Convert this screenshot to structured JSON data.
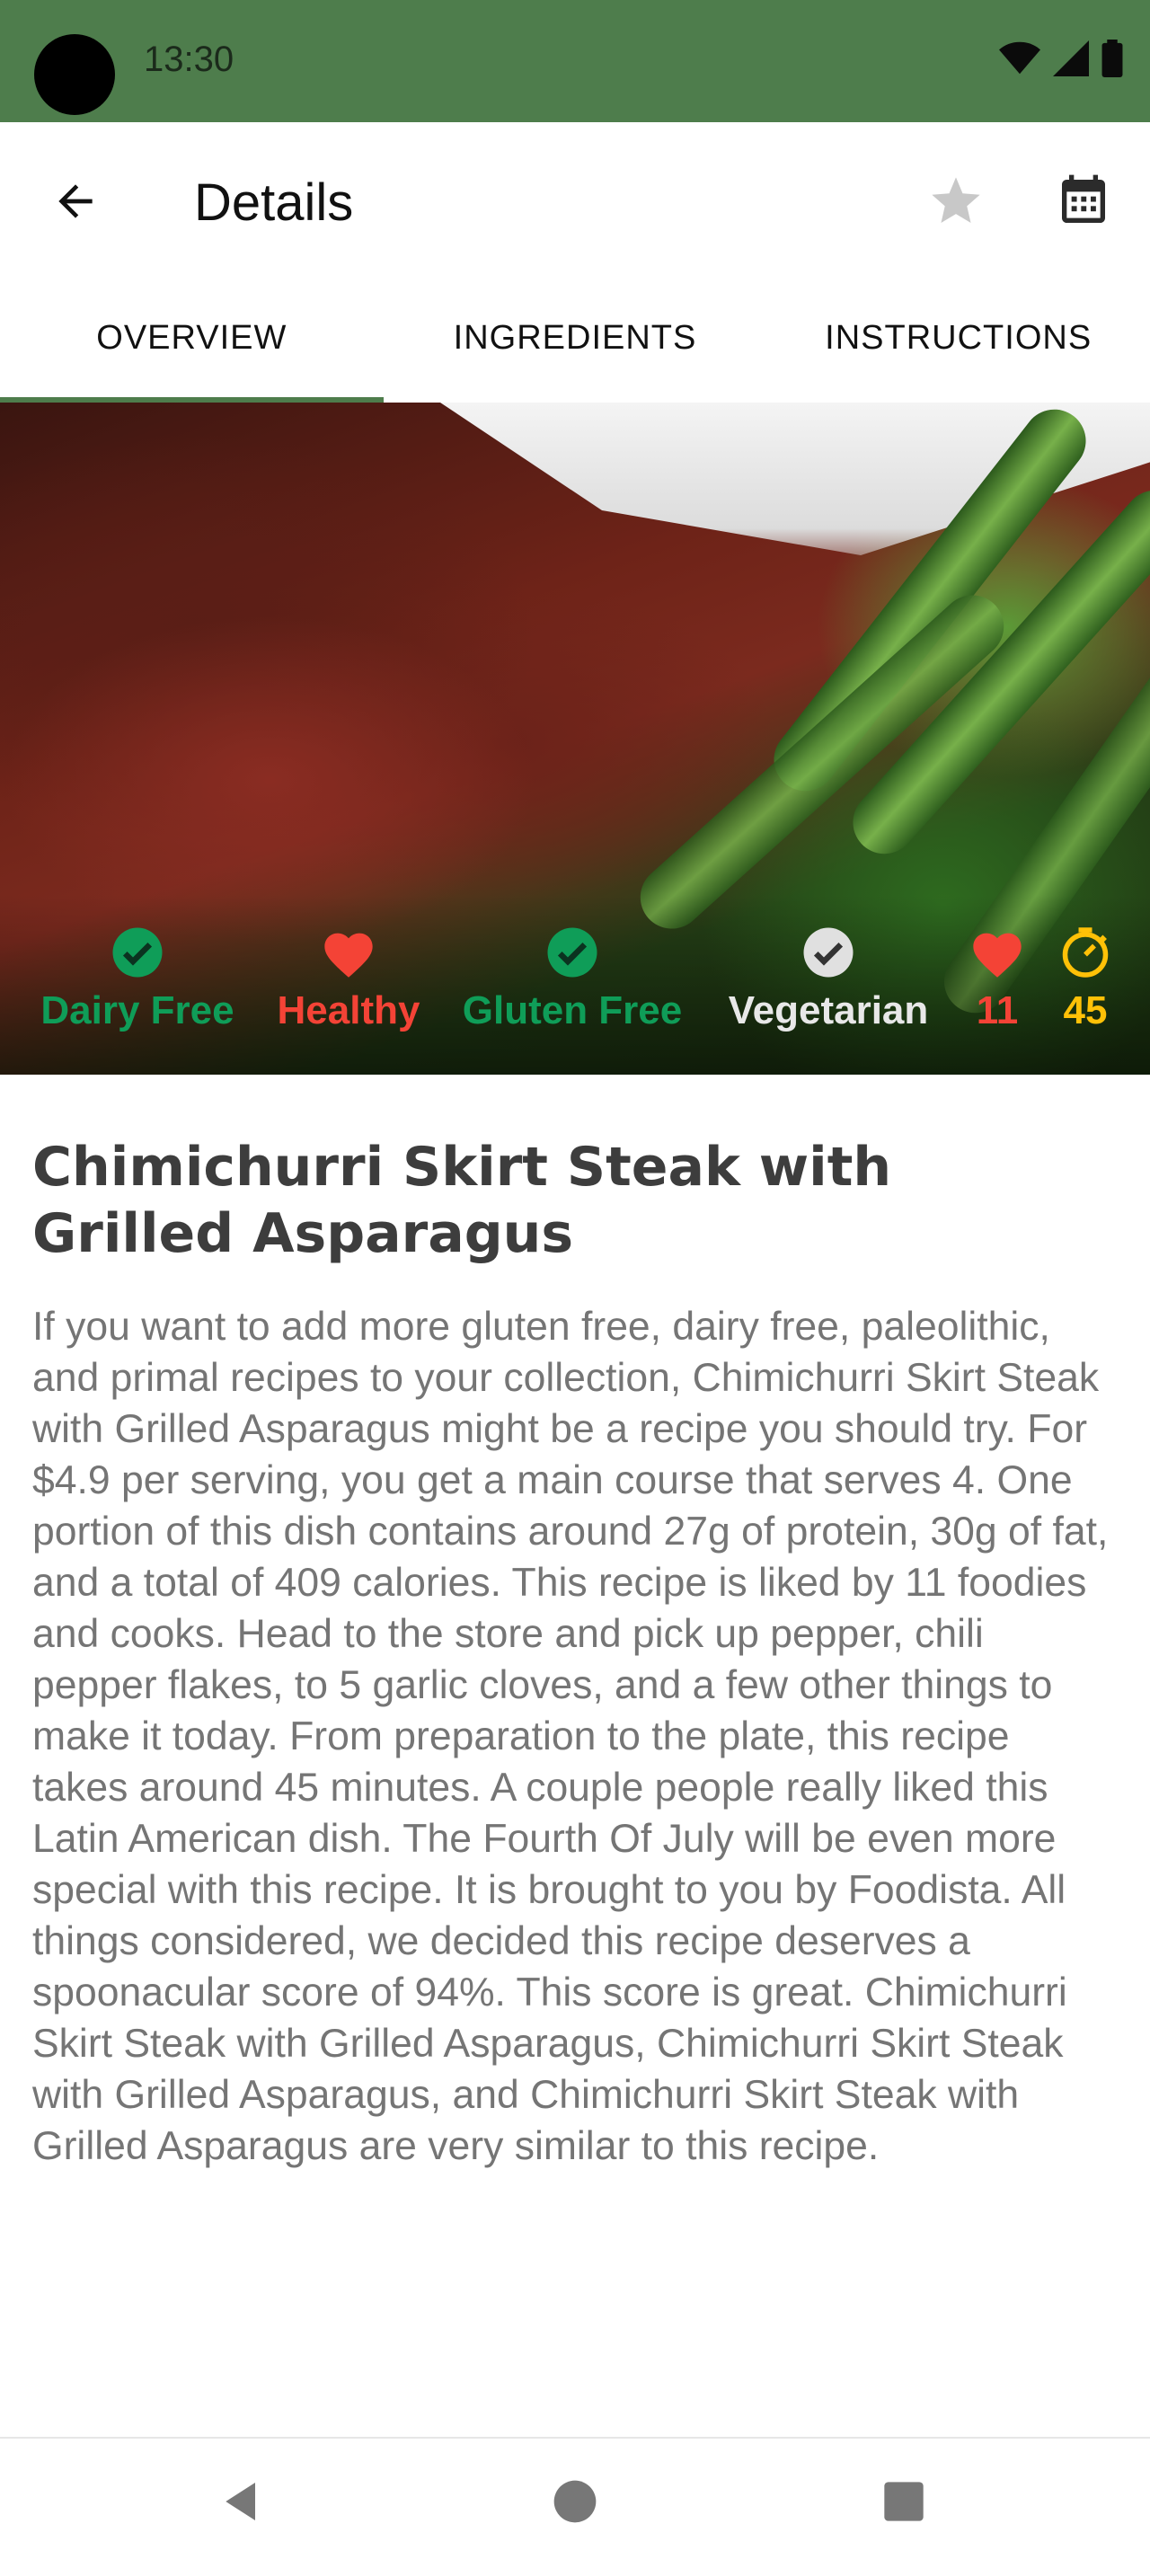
{
  "status_bar": {
    "time": "13:30",
    "color": "#4e7d4c"
  },
  "app_bar": {
    "title": "Details",
    "back_icon": "arrow-back-icon",
    "favorite_icon": "star-icon",
    "calendar_icon": "calendar-icon"
  },
  "tabs": [
    {
      "label": "OVERVIEW",
      "active": true
    },
    {
      "label": "INGREDIENTS",
      "active": false
    },
    {
      "label": "INSTRUCTIONS",
      "active": false
    }
  ],
  "badges": {
    "dairy_free": {
      "label": "Dairy Free",
      "icon": "check-circle-icon",
      "color": "#0f9d58"
    },
    "healthy": {
      "label": "Healthy",
      "icon": "heart-icon",
      "color": "#f44336"
    },
    "gluten_free": {
      "label": "Gluten Free",
      "icon": "check-circle-icon",
      "color": "#0f9d58"
    },
    "vegetarian": {
      "label": "Vegetarian",
      "icon": "check-circle-icon",
      "color": "#e0e0e0"
    },
    "likes": {
      "value": "11",
      "icon": "heart-icon",
      "color": "#f44336"
    },
    "time": {
      "value": "45",
      "icon": "timer-icon",
      "color": "#ffc107"
    }
  },
  "recipe": {
    "title": "Chimichurri Skirt Steak with Grilled Asparagus",
    "summary": "If you want to add more gluten free, dairy free, paleolithic, and primal recipes to your collection, Chimichurri Skirt Steak with Grilled Asparagus might be a recipe you should try. For $4.9 per serving, you get a main course that serves 4. One portion of this dish contains around 27g of protein, 30g of fat, and a total of 409 calories. This recipe is liked by 11 foodies and cooks. Head to the store and pick up pepper, chili pepper flakes, to 5 garlic cloves, and a few other things to make it today. From preparation to the plate, this recipe takes around 45 minutes. A couple people really liked this Latin American dish. The Fourth Of July will be even more special with this recipe. It is brought to you by Foodista. All things considered, we decided this recipe deserves a spoonacular score of 94%. This score is great. Chimichurri Skirt Steak with Grilled Asparagus, Chimichurri Skirt Steak with Grilled Asparagus, and Chimichurri Skirt Steak with Grilled Asparagus are very similar to this recipe."
  },
  "nav_bar": {
    "back": "nav-back-icon",
    "home": "nav-home-icon",
    "recents": "nav-recents-icon"
  }
}
